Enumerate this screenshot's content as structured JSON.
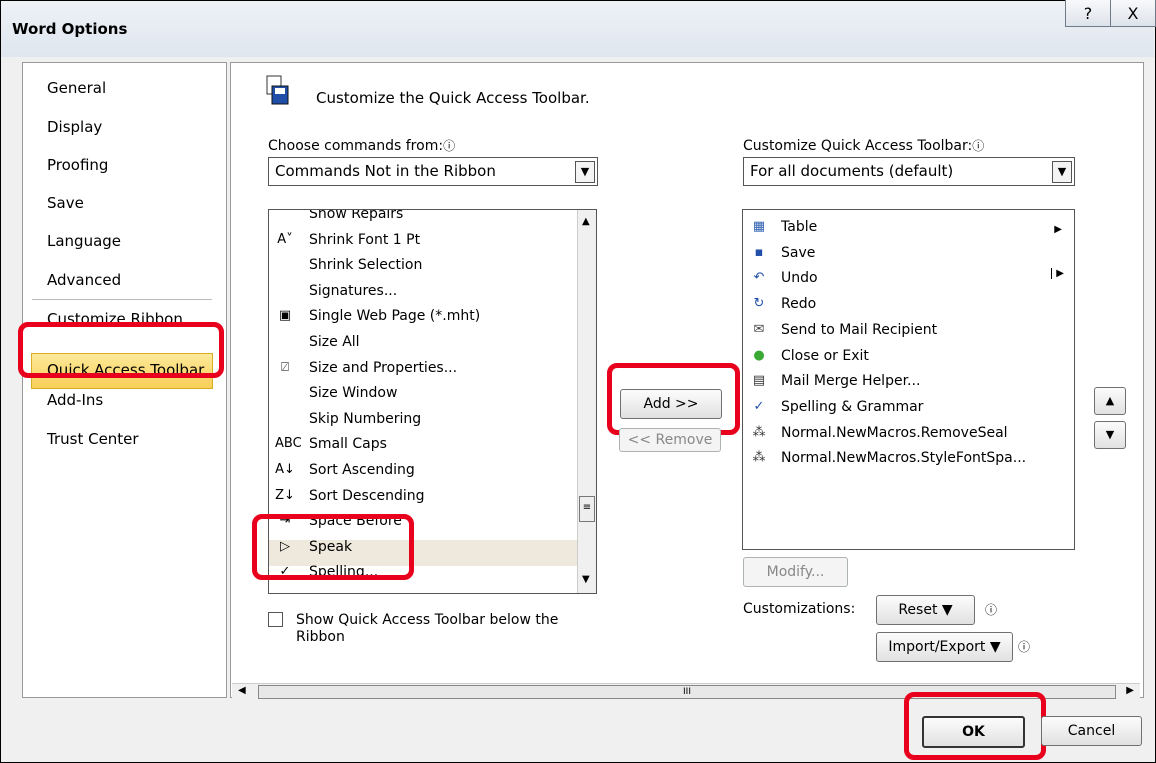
{
  "window": {
    "title": "Word Options",
    "help_glyph": "?",
    "close_glyph": "X"
  },
  "nav": {
    "items": [
      "General",
      "Display",
      "Proofing",
      "Save",
      "Language",
      "Advanced",
      "Customize Ribbon",
      "Quick Access Toolbar",
      "Add-Ins",
      "Trust Center"
    ],
    "selected": "Quick Access Toolbar"
  },
  "main": {
    "heading": "Customize the Quick Access Toolbar.",
    "choose_label": "Choose commands from:",
    "choose_value": "Commands Not in the Ribbon",
    "customize_label": "Customize Quick Access Toolbar:",
    "customize_value": "For all documents (default)",
    "commands": [
      {
        "label": "Show Repairs",
        "icon": ""
      },
      {
        "label": "Shrink Font 1 Pt",
        "icon": "A˅"
      },
      {
        "label": "Shrink Selection",
        "icon": ""
      },
      {
        "label": "Signatures...",
        "icon": ""
      },
      {
        "label": "Single Web Page (*.mht)",
        "icon": "▣"
      },
      {
        "label": "Size All",
        "icon": ""
      },
      {
        "label": "Size and Properties...",
        "icon": "⍁"
      },
      {
        "label": "Size Window",
        "icon": ""
      },
      {
        "label": "Skip Numbering",
        "icon": ""
      },
      {
        "label": "Small Caps",
        "icon": "ABC"
      },
      {
        "label": "Sort Ascending",
        "icon": "A↓"
      },
      {
        "label": "Sort Descending",
        "icon": "Z↓"
      },
      {
        "label": "Space Before",
        "icon": "⇥"
      },
      {
        "label": "Speak",
        "icon": "▷"
      },
      {
        "label": "Spelling...",
        "icon": "✓"
      }
    ],
    "toolbar_items": [
      {
        "label": "Table",
        "icon": "▦",
        "color": "#2a5db0"
      },
      {
        "label": "Save",
        "icon": "▪",
        "color": "#1f4fa8"
      },
      {
        "label": "Undo",
        "icon": "↶",
        "color": "#1f4fa8"
      },
      {
        "label": "Redo",
        "icon": "↻",
        "color": "#1f4fa8"
      },
      {
        "label": "Send to Mail Recipient",
        "icon": "✉",
        "color": "#444"
      },
      {
        "label": "Close or Exit",
        "icon": "●",
        "color": "#3aaa35"
      },
      {
        "label": "Mail Merge Helper...",
        "icon": "▤",
        "color": "#333"
      },
      {
        "label": "Spelling & Grammar",
        "icon": "✓",
        "color": "#1f4fa8"
      },
      {
        "label": "Normal.NewMacros.RemoveSeal",
        "icon": "⁂",
        "color": "#333"
      },
      {
        "label": "Normal.NewMacros.StyleFontSpa...",
        "icon": "⁂",
        "color": "#333"
      }
    ],
    "add_label": "Add >>",
    "remove_label": "<< Remove",
    "modify_label": "Modify...",
    "customizations_label": "Customizations:",
    "reset_label": "Reset ▼",
    "import_export_label": "Import/Export ▼",
    "show_below_label": "Show Quick Access Toolbar below the Ribbon",
    "info_glyph": "ⓘ"
  },
  "footer": {
    "ok_label": "OK",
    "cancel_label": "Cancel"
  },
  "colors": {
    "highlight": "#e8001c",
    "selected_nav": "#f8cf57"
  }
}
